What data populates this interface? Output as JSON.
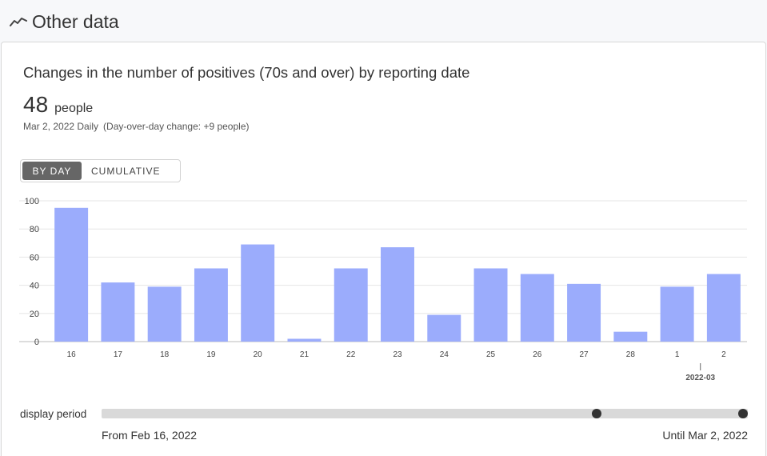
{
  "header": {
    "title": "Other data",
    "icon": "trend-line-icon"
  },
  "card": {
    "title": "Changes in the number of positives (70s and over) by reporting date",
    "value": "48",
    "unit": "people",
    "date_line": "Mar 2, 2022 Daily",
    "change_line": "(Day-over-day change: +9 people)"
  },
  "toggle": {
    "by_day": "By day",
    "cumulative": "Cumulative",
    "selected": "by_day"
  },
  "colors": {
    "bar": "#9bacfc",
    "grid": "#e6e6e6",
    "axis": "#bbbbbb",
    "thumb": "#333333",
    "track": "#d9d9d9"
  },
  "chart_data": {
    "type": "bar",
    "categories": [
      "16",
      "17",
      "18",
      "19",
      "20",
      "21",
      "22",
      "23",
      "24",
      "25",
      "26",
      "27",
      "28",
      "1",
      "2"
    ],
    "values": [
      95,
      42,
      39,
      52,
      69,
      2,
      52,
      67,
      19,
      52,
      48,
      41,
      7,
      39,
      48
    ],
    "month_marker": {
      "label": "2022-03",
      "category": "1"
    },
    "ylim": [
      0,
      100
    ],
    "yticks": [
      0,
      20,
      40,
      60,
      80,
      100
    ],
    "grid": true
  },
  "slider": {
    "label": "display period",
    "from": "From Feb 16, 2022",
    "until": "Until Mar 2, 2022",
    "range": [
      0.77,
      1.0
    ]
  }
}
